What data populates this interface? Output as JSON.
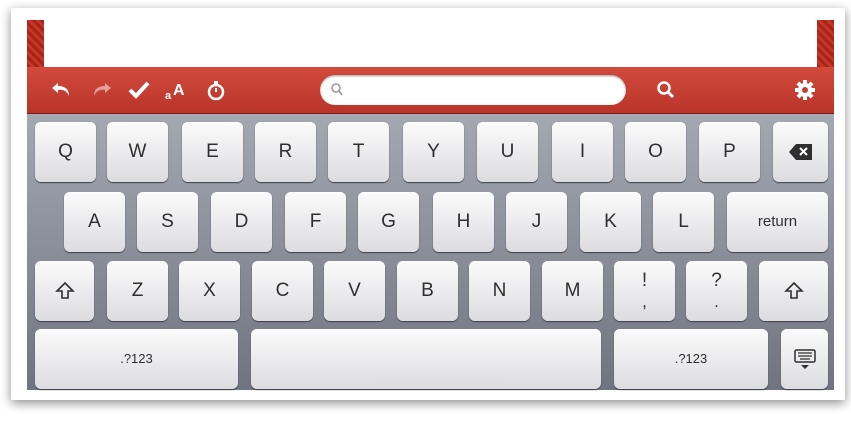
{
  "toolbar": {
    "icons": [
      "undo-icon",
      "redo-icon",
      "checkmark-icon",
      "text-size-icon",
      "timer-icon",
      "search-icon",
      "settings-gear-icon"
    ],
    "search": {
      "placeholder": "",
      "value": ""
    }
  },
  "keyboard": {
    "row1": [
      "Q",
      "W",
      "E",
      "R",
      "T",
      "Y",
      "U",
      "I",
      "O",
      "P"
    ],
    "row2": [
      "A",
      "S",
      "D",
      "F",
      "G",
      "H",
      "J",
      "K",
      "L"
    ],
    "row3": [
      "Z",
      "X",
      "C",
      "V",
      "B",
      "N",
      "M"
    ],
    "return_label": "return",
    "numbers_label_left": ".?123",
    "numbers_label_right": ".?123",
    "exclamation": {
      "top": "!",
      "bottom": ","
    },
    "question": {
      "top": "?",
      "bottom": "."
    }
  },
  "colors": {
    "toolbar": "#c43c30",
    "keyboard": "#8a8f99",
    "key": "#f2f2f4"
  }
}
